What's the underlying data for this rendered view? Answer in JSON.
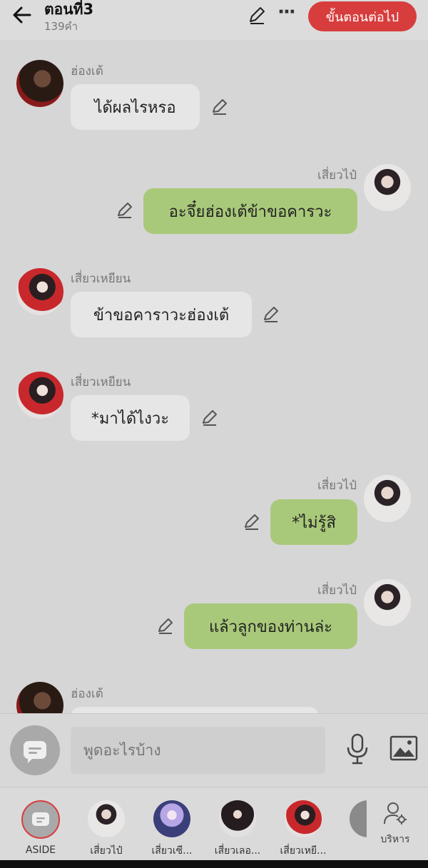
{
  "header": {
    "title": "ตอนที่3",
    "word_count": "139คำ",
    "next_label": "ขั้นตอนต่อไป"
  },
  "messages": [
    {
      "side": "left",
      "avatar": "hong",
      "name": "ฮ่องเต้",
      "text": "ได้ผลไรหรอ"
    },
    {
      "side": "right",
      "avatar": "siao",
      "name": "เสี่ยวไป๋",
      "text": "อะจึ๋ยฮ่องเต้ข้าขอคารวะ"
    },
    {
      "side": "left",
      "avatar": "yian",
      "name": "เสี่ยวเหยียน",
      "text": "ข้าขอคาราวะฮ่องเต้"
    },
    {
      "side": "left",
      "avatar": "yian",
      "name": "เสี่ยวเหยียน",
      "text": "*มาได้ไงวะ"
    },
    {
      "side": "right",
      "avatar": "siao",
      "name": "เสี่ยวไป๋",
      "text": "*ไม่รู้สิ"
    },
    {
      "side": "right",
      "avatar": "siao",
      "name": "เสี่ยวไป๋",
      "text": "แล้วลูกของท่านล่ะ"
    },
    {
      "side": "left",
      "avatar": "hong",
      "name": "ฮ่องเต้",
      "text": ""
    }
  ],
  "input": {
    "placeholder": "พูดอะไรบ้าง"
  },
  "characters": [
    {
      "label": "ASIDE",
      "color": "#a9a9a9"
    },
    {
      "label": "เสี่ยวไป๋",
      "color": "#e0dada"
    },
    {
      "label": "เสี่ยวเซี...",
      "color": "#8a8ed8"
    },
    {
      "label": "เสี่ยวเลอ...",
      "color": "#3a3033"
    },
    {
      "label": "เสี่ยวเหยี...",
      "color": "#c8383a"
    },
    {
      "label": "",
      "color": "#8a8a8a"
    }
  ],
  "admin_label": "บริหาร",
  "colors": {
    "accent": "#d83d3d",
    "bubble_right": "#a9c97a",
    "bubble_left": "#e6e6e6"
  }
}
